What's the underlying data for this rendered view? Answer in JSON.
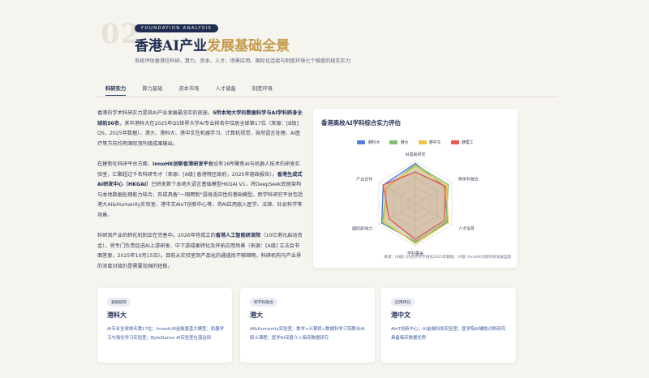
{
  "header": {
    "number": "02",
    "tag": "FOUNDATION ANALYSIS",
    "title_main": "香港AI产业",
    "title_highlight": "发展基础全景",
    "subtitle": "系统评估香港在科研、算力、资本、人才、场景应用、国际化连接与制度环境七个维度的现实实力"
  },
  "tabs": [
    "科研实力",
    "算力基础",
    "资本市场",
    "人才储备",
    "制度环境"
  ],
  "paragraphs": [
    {
      "segments": [
        {
          "text": "香港的学术科研实力是其AI产业发展最坚实的底座。",
          "bold": false
        },
        {
          "text": "5所本地大学的数据科学与AI学科跻身全球前50名",
          "bold": true
        },
        {
          "text": "，其中港科大在2025年QS世界大学AI专业排名中位居全球第17位（来源：[B级] QS，2025年数据）。港大、港科大、港中文在机器学习、计算机视觉、自然语言处理、AI医疗等方向均有国际顶刊级成果输出。",
          "bold": false
        }
      ]
    },
    {
      "segments": [
        {
          "text": "在建制化科研平台方面，",
          "bold": false
        },
        {
          "text": "InnoHK创新香港研发平台",
          "bold": true
        },
        {
          "text": "设有16所聚焦AI与机器人技术的研发实验室，汇聚超过千名科研专才（来源：[A级] 香港特区政府，2025年施政报告）。",
          "bold": false
        },
        {
          "text": "香港生成式AI研发中心（HKGAI）",
          "bold": true
        },
        {
          "text": "已研发首个本地大语言基础模型HKGAI V1，将DeepSeek底座架构与本地数据处理能力结合，形成具备\"一国两制\"语境适应性的基础模型。跨学科研究平台包括港大AI&Humanity实验室、港中文AIoT创新中心等，将AI应用嵌入医学、法律、社会科学等场景。",
          "bold": false
        }
      ]
    },
    {
      "segments": [
        {
          "text": "科研到产业的转化机制正在完善中。2026年将成立的",
          "bold": false
        },
        {
          "text": "香港人工智能研发院",
          "bold": true
        },
        {
          "text": "（10亿港元启动资金），将专门负责促进AI上游研发、中下游成果转化及开拓应用场景（来源：[A级] 立法会书面答复，2025年10月15日）。目前从实验室到产品化的通道尚不够顺畅，科研机构与产业界的深度对接仍是需要加强的短板。",
          "bold": false
        }
      ]
    }
  ],
  "chart_card": {
    "title": "香港高校AI学科综合实力评估",
    "source": "来源：[B级] QS世界大学排名2025年数据；[A级] InnoHK创新科技发展蓝图"
  },
  "chart_data": {
    "type": "radar",
    "axes": [
      "AI基础研究",
      "跨学科融合",
      "人才培育",
      "学科覆盖",
      "国际影响力",
      "产业合作"
    ],
    "ylim": [
      0,
      100
    ],
    "series": [
      {
        "name": "港科大",
        "color": "#4f7fd6",
        "values": [
          95,
          80,
          88,
          90,
          92,
          88
        ]
      },
      {
        "name": "港大",
        "color": "#7cc26a",
        "values": [
          92,
          90,
          85,
          92,
          90,
          78
        ]
      },
      {
        "name": "港中文",
        "color": "#efc348",
        "values": [
          88,
          85,
          90,
          95,
          85,
          80
        ]
      },
      {
        "name": "港理工",
        "color": "#e4584f",
        "values": [
          75,
          82,
          80,
          85,
          72,
          88
        ]
      }
    ]
  },
  "cards": [
    {
      "badge": "基础研究",
      "name": "港科大",
      "desc": "AI专业全球排名第17位；InvestLM金融垂直大模型；机器学习与强化学习实验室；ByteDance AI实验室在港驻研"
    },
    {
      "badge": "跨学科融合",
      "name": "港大",
      "desc": "AI&Humanity实验室；数学+计算机+数据科学三院联合AI硕士课程；医学AI深度介入临床数据研究"
    },
    {
      "badge": "应用转化",
      "name": "港中文",
      "desc": "AIoT创新中心；AI金融科技实验室；医学院AI辅助诊断研究具备临床数据优势"
    }
  ]
}
